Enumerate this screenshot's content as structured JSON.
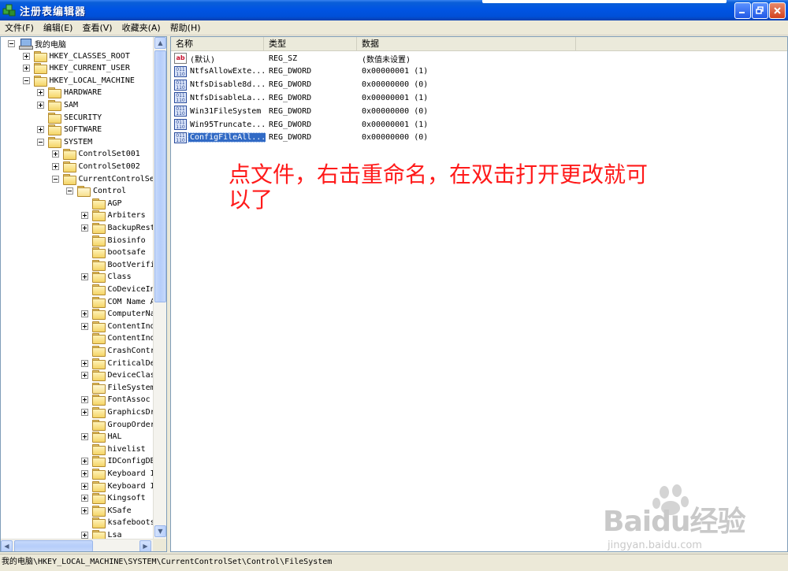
{
  "window": {
    "title": "注册表编辑器",
    "buttons": {
      "minimize": "_",
      "maximize": "❐",
      "close": "✕"
    }
  },
  "menu": [
    "文件(F)",
    "编辑(E)",
    "查看(V)",
    "收藏夹(A)",
    "帮助(H)"
  ],
  "tree": [
    {
      "label": "我的电脑",
      "level": 0,
      "expander": "minus",
      "icon": "computer-icon"
    },
    {
      "label": "HKEY_CLASSES_ROOT",
      "level": 1,
      "expander": "plus",
      "icon": "folder-icon"
    },
    {
      "label": "HKEY_CURRENT_USER",
      "level": 1,
      "expander": "plus",
      "icon": "folder-icon"
    },
    {
      "label": "HKEY_LOCAL_MACHINE",
      "level": 1,
      "expander": "minus",
      "icon": "folder-icon"
    },
    {
      "label": "HARDWARE",
      "level": 2,
      "expander": "plus",
      "icon": "folder-icon"
    },
    {
      "label": "SAM",
      "level": 2,
      "expander": "plus",
      "icon": "folder-icon"
    },
    {
      "label": "SECURITY",
      "level": 2,
      "expander": "none",
      "icon": "folder-icon"
    },
    {
      "label": "SOFTWARE",
      "level": 2,
      "expander": "plus",
      "icon": "folder-icon"
    },
    {
      "label": "SYSTEM",
      "level": 2,
      "expander": "minus",
      "icon": "folder-icon"
    },
    {
      "label": "ControlSet001",
      "level": 3,
      "expander": "plus",
      "icon": "folder-icon"
    },
    {
      "label": "ControlSet002",
      "level": 3,
      "expander": "plus",
      "icon": "folder-icon"
    },
    {
      "label": "CurrentControlSe",
      "level": 3,
      "expander": "minus",
      "icon": "folder-icon"
    },
    {
      "label": "Control",
      "level": 4,
      "expander": "minus",
      "icon": "folder-open-icon"
    },
    {
      "label": "AGP",
      "level": 5,
      "expander": "none",
      "icon": "folder-icon"
    },
    {
      "label": "Arbiters",
      "level": 5,
      "expander": "plus",
      "icon": "folder-icon"
    },
    {
      "label": "BackupRest",
      "level": 5,
      "expander": "plus",
      "icon": "folder-icon"
    },
    {
      "label": "Biosinfo",
      "level": 5,
      "expander": "none",
      "icon": "folder-icon"
    },
    {
      "label": "bootsafe",
      "level": 5,
      "expander": "none",
      "icon": "folder-icon"
    },
    {
      "label": "BootVerifi",
      "level": 5,
      "expander": "none",
      "icon": "folder-icon"
    },
    {
      "label": "Class",
      "level": 5,
      "expander": "plus",
      "icon": "folder-icon"
    },
    {
      "label": "CoDeviceIn",
      "level": 5,
      "expander": "none",
      "icon": "folder-icon"
    },
    {
      "label": "COM Name A",
      "level": 5,
      "expander": "none",
      "icon": "folder-icon"
    },
    {
      "label": "ComputerNa",
      "level": 5,
      "expander": "plus",
      "icon": "folder-icon"
    },
    {
      "label": "ContentInd",
      "level": 5,
      "expander": "plus",
      "icon": "folder-icon"
    },
    {
      "label": "ContentInd",
      "level": 5,
      "expander": "none",
      "icon": "folder-icon"
    },
    {
      "label": "CrashContr",
      "level": 5,
      "expander": "none",
      "icon": "folder-icon"
    },
    {
      "label": "CriticalDe",
      "level": 5,
      "expander": "plus",
      "icon": "folder-icon"
    },
    {
      "label": "DeviceClas",
      "level": 5,
      "expander": "plus",
      "icon": "folder-icon"
    },
    {
      "label": "FileSystem",
      "level": 5,
      "expander": "none",
      "icon": "folder-open-icon"
    },
    {
      "label": "FontAssoc",
      "level": 5,
      "expander": "plus",
      "icon": "folder-icon"
    },
    {
      "label": "GraphicsDr",
      "level": 5,
      "expander": "plus",
      "icon": "folder-icon"
    },
    {
      "label": "GroupOrder",
      "level": 5,
      "expander": "none",
      "icon": "folder-icon"
    },
    {
      "label": "HAL",
      "level": 5,
      "expander": "plus",
      "icon": "folder-icon"
    },
    {
      "label": "hivelist",
      "level": 5,
      "expander": "none",
      "icon": "folder-icon"
    },
    {
      "label": "IDConfigDB",
      "level": 5,
      "expander": "plus",
      "icon": "folder-icon"
    },
    {
      "label": "Keyboard I",
      "level": 5,
      "expander": "plus",
      "icon": "folder-icon"
    },
    {
      "label": "Keyboard I",
      "level": 5,
      "expander": "plus",
      "icon": "folder-icon"
    },
    {
      "label": "Kingsoft",
      "level": 5,
      "expander": "plus",
      "icon": "folder-icon"
    },
    {
      "label": "KSafe",
      "level": 5,
      "expander": "plus",
      "icon": "folder-icon"
    },
    {
      "label": "ksafeboots",
      "level": 5,
      "expander": "none",
      "icon": "folder-icon"
    },
    {
      "label": "Lsa",
      "level": 5,
      "expander": "plus",
      "icon": "folder-icon"
    }
  ],
  "columns": [
    "名称",
    "类型",
    "数据"
  ],
  "values": [
    {
      "name": "(默认)",
      "type": "REG_SZ",
      "data": "(数值未设置)",
      "icon": "string-value-icon",
      "icon_text": "ab"
    },
    {
      "name": "NtfsAllowExte...",
      "type": "REG_DWORD",
      "data": "0x00000001 (1)",
      "icon": "dword-value-icon",
      "icon_text": "011\n110"
    },
    {
      "name": "NtfsDisable8d...",
      "type": "REG_DWORD",
      "data": "0x00000000 (0)",
      "icon": "dword-value-icon",
      "icon_text": "011\n110"
    },
    {
      "name": "NtfsDisableLa...",
      "type": "REG_DWORD",
      "data": "0x00000001 (1)",
      "icon": "dword-value-icon",
      "icon_text": "011\n110"
    },
    {
      "name": "Win31FileSystem",
      "type": "REG_DWORD",
      "data": "0x00000000 (0)",
      "icon": "dword-value-icon",
      "icon_text": "011\n110"
    },
    {
      "name": "Win95Truncate...",
      "type": "REG_DWORD",
      "data": "0x00000001 (1)",
      "icon": "dword-value-icon",
      "icon_text": "011\n110"
    },
    {
      "name": "ConfigFileAll...",
      "type": "REG_DWORD",
      "data": "0x00000000 (0)",
      "icon": "dword-value-icon",
      "icon_text": "011\n110",
      "selected": true
    }
  ],
  "annotation": "点文件，右击重命名，在双击打开更改就可以了",
  "status_path": "我的电脑\\HKEY_LOCAL_MACHINE\\SYSTEM\\CurrentControlSet\\Control\\FileSystem",
  "watermark": {
    "logo": "Baidu经验",
    "site": "jingyan.baidu.com"
  },
  "colors": {
    "titlebar": "#0054e3",
    "selection": "#316ac5",
    "annotation": "#ff1a1a"
  }
}
